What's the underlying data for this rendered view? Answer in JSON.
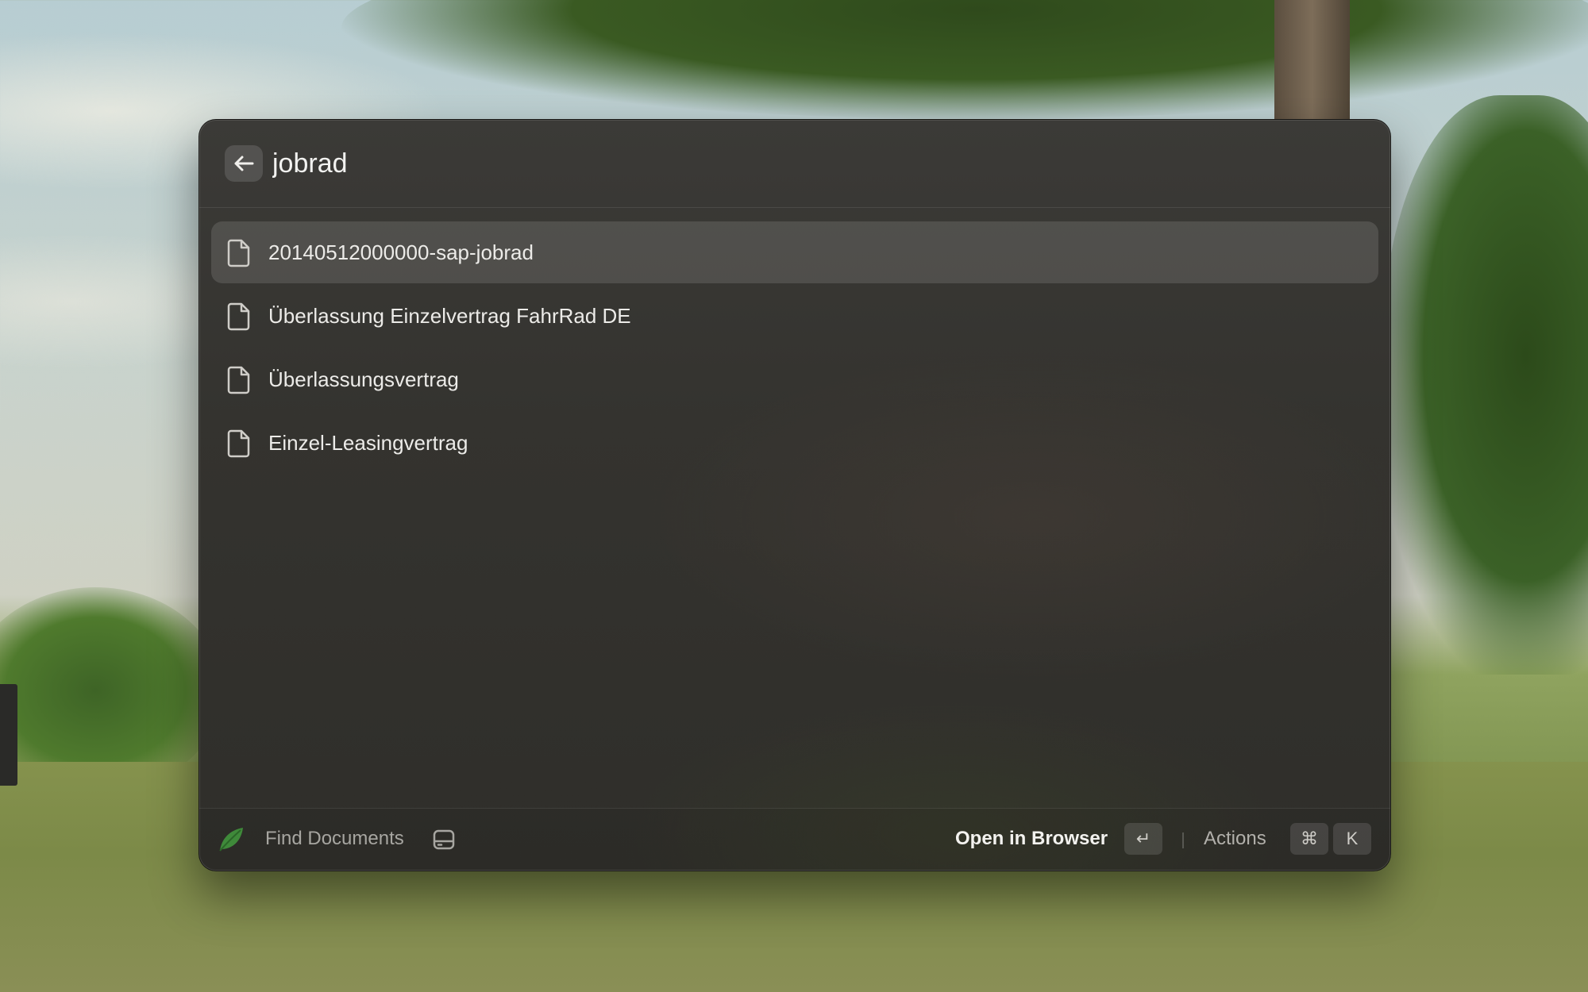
{
  "search": {
    "query": "jobrad"
  },
  "results": [
    {
      "label": "20140512000000-sap-jobrad",
      "icon": "document-icon",
      "selected": true
    },
    {
      "label": "Überlassung Einzelvertrag FahrRad DE",
      "icon": "document-icon",
      "selected": false
    },
    {
      "label": "Überlassungsvertrag",
      "icon": "document-icon",
      "selected": false
    },
    {
      "label": "Einzel-Leasingvertrag",
      "icon": "document-icon",
      "selected": false
    }
  ],
  "footer": {
    "extension_title": "Find Documents",
    "extension_icon": "leaf-icon",
    "primary_action_label": "Open in Browser",
    "primary_action_key": "↵",
    "actions_label": "Actions",
    "actions_keys": [
      "⌘",
      "K"
    ]
  },
  "colors": {
    "window_background": "#34332f",
    "selected_row": "#4a4945",
    "text_primary": "#ecebe8",
    "text_secondary": "#a7a6a1",
    "leaf_accent": "#3f8a3a"
  }
}
